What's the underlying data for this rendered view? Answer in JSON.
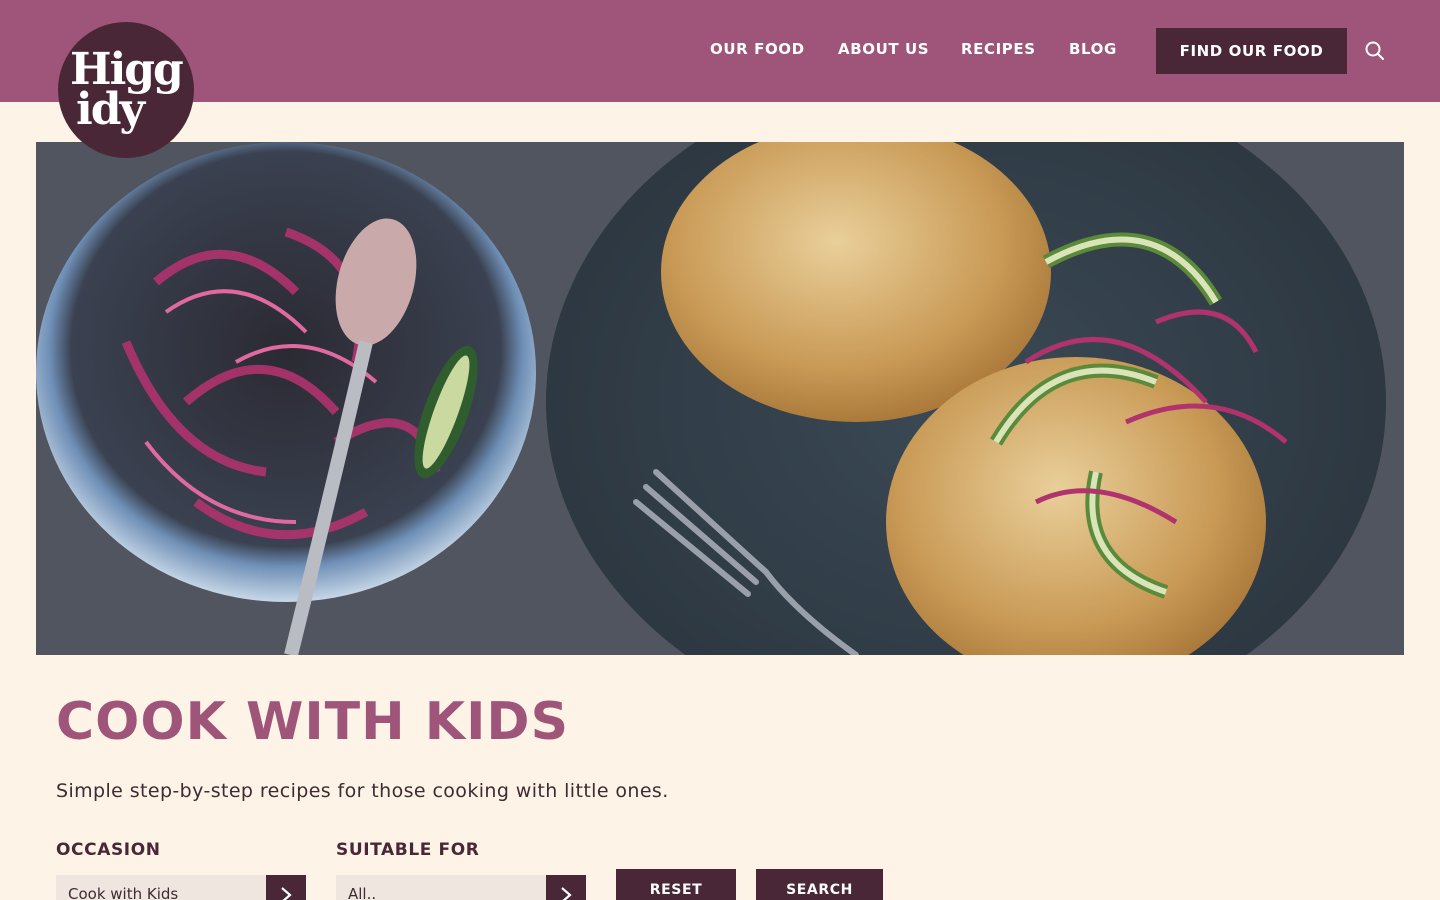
{
  "brand": {
    "logo_line1": "Higg",
    "logo_line2": "idy"
  },
  "nav": {
    "items": [
      {
        "label": "OUR FOOD"
      },
      {
        "label": "ABOUT US"
      },
      {
        "label": "RECIPES"
      },
      {
        "label": "BLOG"
      }
    ],
    "cta_label": "FIND OUR FOOD",
    "search_icon": "search-icon"
  },
  "page": {
    "title": "COOK WITH KIDS",
    "subtitle": "Simple step-by-step recipes for those cooking with little ones."
  },
  "filters": {
    "occasion": {
      "label": "OCCASION",
      "value": "Cook with Kids"
    },
    "suitable_for": {
      "label": "SUITABLE FOR",
      "value": "All.."
    },
    "reset_label": "RESET",
    "search_label": "SEARCH"
  },
  "colors": {
    "header": "#9e5579",
    "dark_plum": "#4a2736",
    "background": "#fdf3e6",
    "title": "#9e5579"
  }
}
